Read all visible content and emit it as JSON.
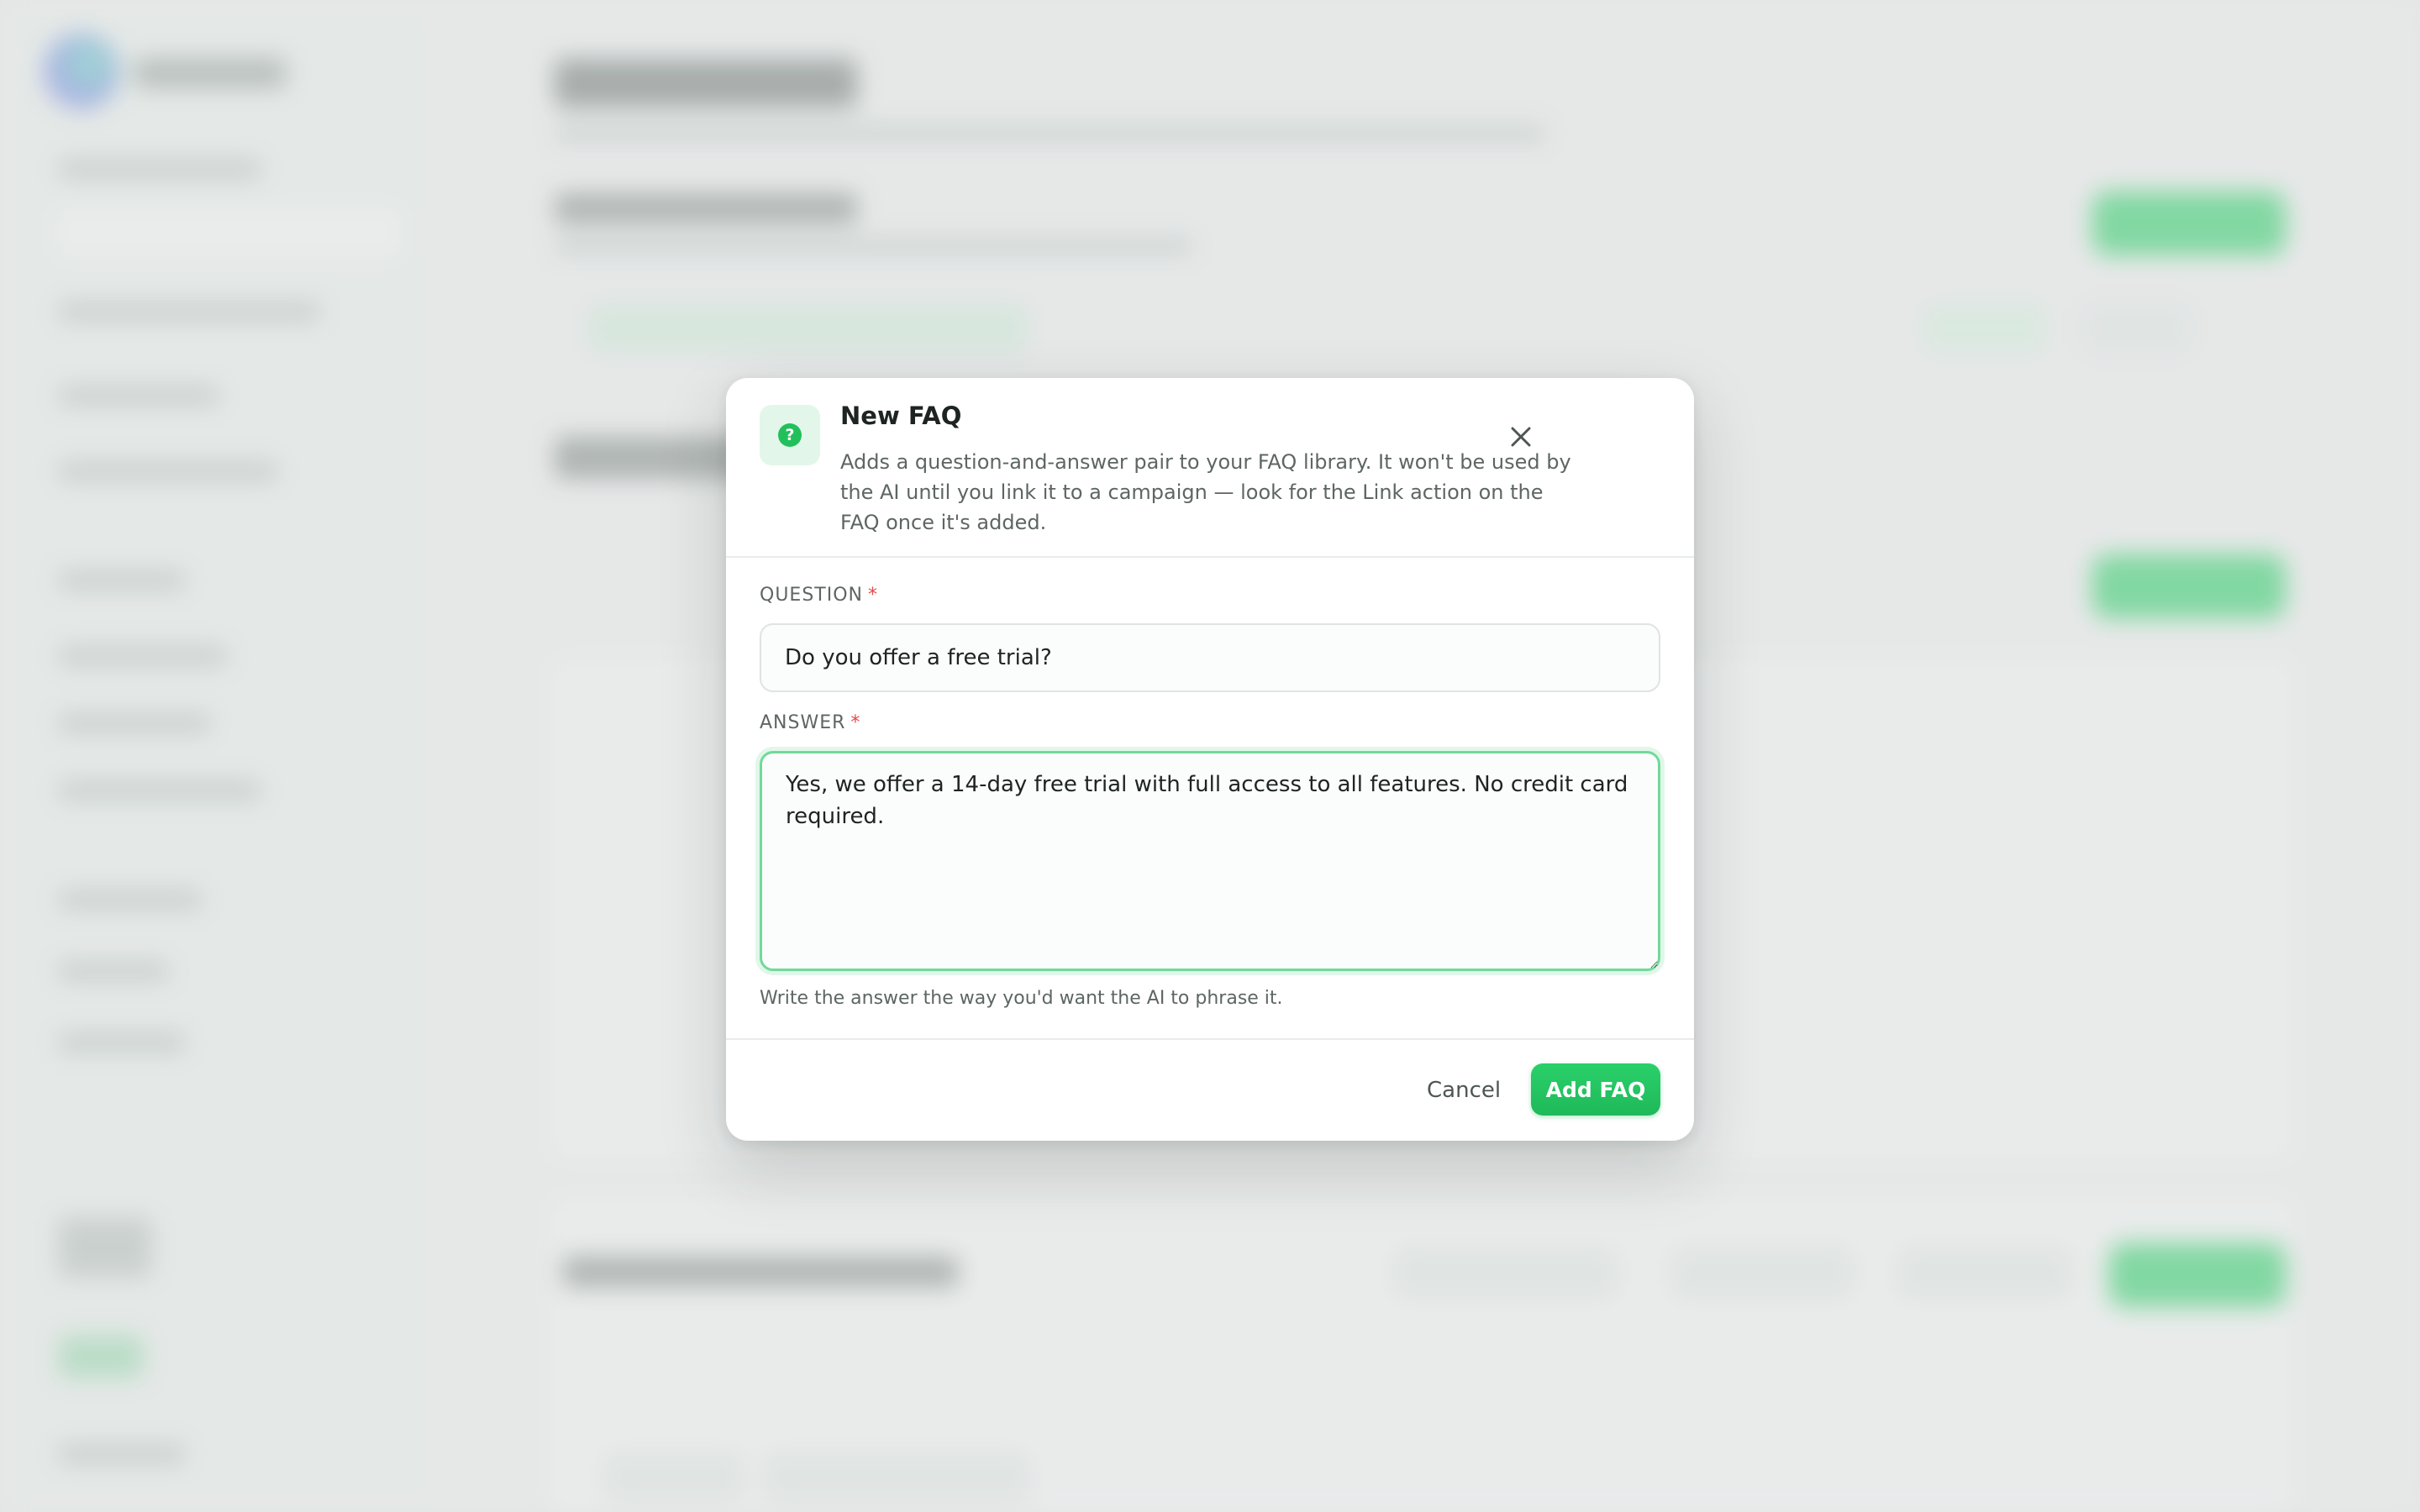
{
  "modal": {
    "title": "New FAQ",
    "icon": "question-circle-icon",
    "description": "Adds a question-and-answer pair to your FAQ library. It won't be used by the AI until you link it to a campaign — look for the Link action on the FAQ once it's added.",
    "close_icon": "close-icon"
  },
  "form": {
    "question": {
      "label": "QUESTION",
      "required_mark": "*",
      "value": "Do you offer a free trial?"
    },
    "answer": {
      "label": "ANSWER",
      "required_mark": "*",
      "value": "Yes, we offer a 14-day free trial with full access to all features. No credit card required.",
      "help": "Write the answer the way you'd want the AI to phrase it."
    }
  },
  "footer": {
    "cancel_label": "Cancel",
    "submit_label": "Add FAQ"
  },
  "colors": {
    "accent": "#22c05a",
    "required": "#e5484d",
    "focus_border": "#72d99a"
  }
}
